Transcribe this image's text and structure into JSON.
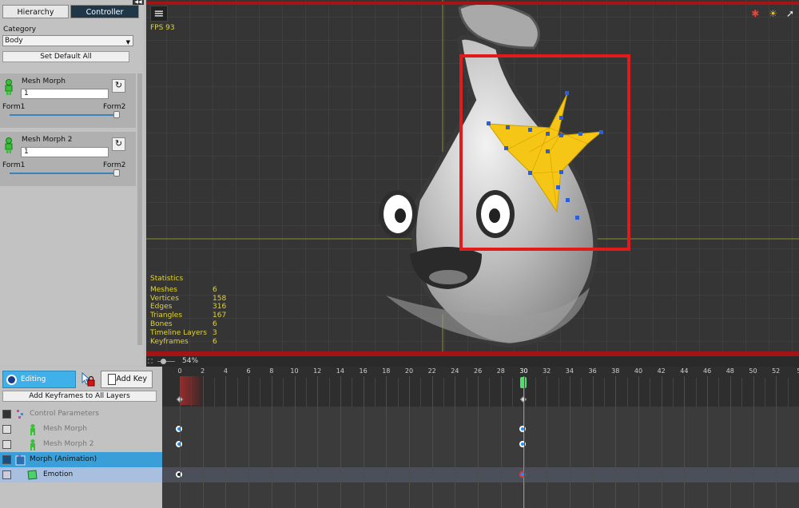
{
  "left_panel": {
    "collapse_glyph": "◀◀",
    "tabs": [
      {
        "label": "Hierarchy"
      },
      {
        "label": "Controller"
      }
    ],
    "category_label": "Category",
    "category_value": "Body",
    "set_default_label": "Set Default All",
    "morphs": [
      {
        "title": "Mesh Morph",
        "value": "1",
        "form1": "Form1",
        "form2": "Form2",
        "slider_fraction": 1.0
      },
      {
        "title": "Mesh Morph 2",
        "value": "1",
        "form1": "Form1",
        "form2": "Form2",
        "slider_fraction": 1.0
      }
    ]
  },
  "viewport": {
    "fps": "FPS 93",
    "stats_title": "Statistics",
    "stats": [
      {
        "k": "Meshes",
        "v": "6"
      },
      {
        "k": "Vertices",
        "v": "158"
      },
      {
        "k": "Edges",
        "v": "316"
      },
      {
        "k": "Triangles",
        "v": "167"
      },
      {
        "k": "Bones",
        "v": "6"
      },
      {
        "k": "Timeline Layers",
        "v": "3"
      },
      {
        "k": "Keyframes",
        "v": "6"
      }
    ],
    "zoom": "54%"
  },
  "timeline": {
    "editing_label": "Editing",
    "add_key_label": "Add Key",
    "add_all_label": "Add Keyframes to All Layers",
    "frame_ticks": [
      "0",
      "2",
      "4",
      "6",
      "8",
      "10",
      "12",
      "14",
      "16",
      "18",
      "20",
      "22",
      "24",
      "26",
      "28",
      "30",
      "32",
      "34",
      "36",
      "38",
      "40",
      "42",
      "44",
      "46",
      "48",
      "50",
      "52",
      "5"
    ],
    "current_frame": 30,
    "layers": [
      {
        "label": "Control Parameters",
        "muted": true
      },
      {
        "label": "Mesh Morph",
        "muted": true
      },
      {
        "label": "Mesh Morph 2",
        "muted": true
      },
      {
        "label": "Morph (Animation)",
        "muted": false
      },
      {
        "label": "Emotion",
        "muted": false
      }
    ]
  },
  "colors": {
    "accent": "#3fb0e8",
    "selection_red": "#e11b1b",
    "star": "#f6c616",
    "stats_text": "#e0d23a"
  }
}
